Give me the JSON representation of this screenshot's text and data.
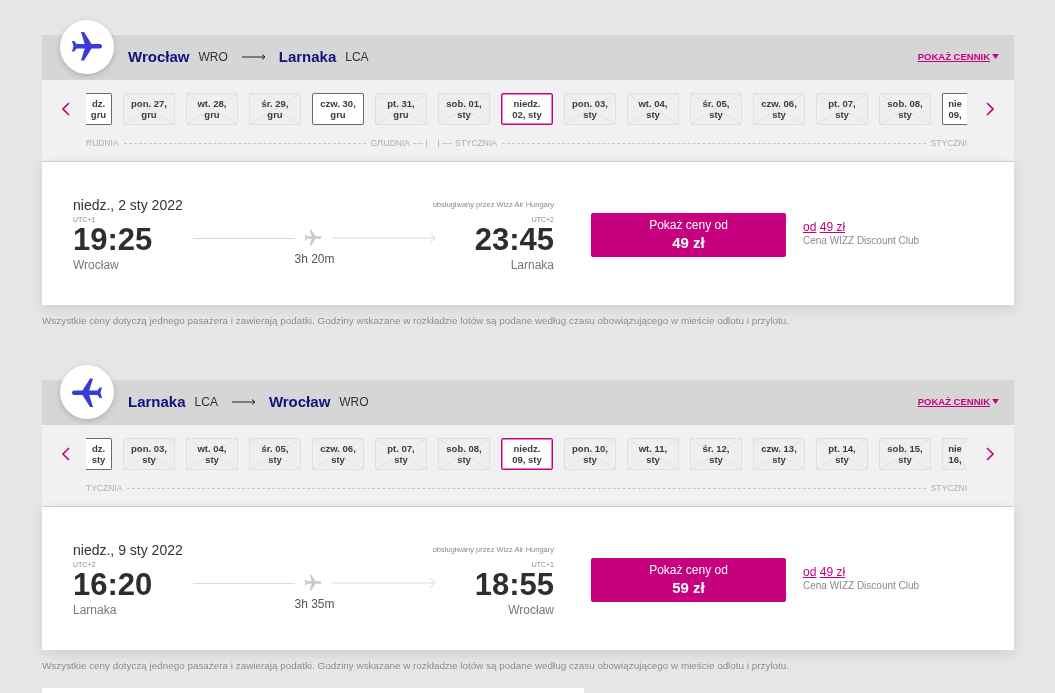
{
  "sections": [
    {
      "route": {
        "return_flight": false,
        "origin": {
          "city": "Wrocław",
          "code": "WRO"
        },
        "destination": {
          "city": "Larnaka",
          "code": "LCA"
        }
      },
      "price_list_link": "POKAŻ CENNIK",
      "date_strip": {
        "months": [
          {
            "start_label": "RUDNIA",
            "end_label": "GRUDNIA",
            "dates": [
              {
                "kind": "cutleft",
                "lines": [
                  "dz.",
                  "gru"
                ],
                "available": true,
                "selected": false
              },
              {
                "kind": "full",
                "lines": [
                  "pon. 27,",
                  "gru"
                ],
                "available": false,
                "selected": false
              },
              {
                "kind": "full",
                "lines": [
                  "wt. 28,",
                  "gru"
                ],
                "available": false,
                "selected": false
              },
              {
                "kind": "full",
                "lines": [
                  "śr. 29,",
                  "gru"
                ],
                "available": false,
                "selected": false
              },
              {
                "kind": "full",
                "lines": [
                  "czw. 30,",
                  "gru"
                ],
                "available": true,
                "selected": false
              },
              {
                "kind": "full",
                "lines": [
                  "pt. 31,",
                  "gru"
                ],
                "available": false,
                "selected": false
              }
            ]
          },
          {
            "start_label": "STYCZNIA",
            "end_label": "STYCZNI",
            "dates": [
              {
                "kind": "full",
                "lines": [
                  "sob. 01,",
                  "sty"
                ],
                "available": false,
                "selected": false
              },
              {
                "kind": "full",
                "lines": [
                  "niedz.",
                  "02, sty"
                ],
                "available": true,
                "selected": true
              },
              {
                "kind": "full",
                "lines": [
                  "pon. 03,",
                  "sty"
                ],
                "available": false,
                "selected": false
              },
              {
                "kind": "full",
                "lines": [
                  "wt. 04,",
                  "sty"
                ],
                "available": false,
                "selected": false
              },
              {
                "kind": "full",
                "lines": [
                  "śr. 05,",
                  "sty"
                ],
                "available": false,
                "selected": false
              },
              {
                "kind": "full",
                "lines": [
                  "czw. 06,",
                  "sty"
                ],
                "available": false,
                "selected": false
              },
              {
                "kind": "full",
                "lines": [
                  "pt. 07,",
                  "sty"
                ],
                "available": false,
                "selected": false
              },
              {
                "kind": "full",
                "lines": [
                  "sob. 08,",
                  "sty"
                ],
                "available": false,
                "selected": false
              },
              {
                "kind": "cutright",
                "lines": [
                  "nie",
                  "09,"
                ],
                "available": true,
                "selected": false
              }
            ]
          }
        ]
      },
      "flight": {
        "date": "niedz., 2 sty 2022",
        "operator": "obsługiwany przez Wizz Air Hungary",
        "departure": {
          "utc": "UTC+1",
          "time": "19:25",
          "city": "Wrocław"
        },
        "duration": "3h 20m",
        "arrival": {
          "utc": "UTC+2",
          "time": "23:45",
          "city": "Larnaka"
        },
        "price_button": {
          "label": "Pokaż ceny od",
          "price": "49 zł"
        },
        "club_price": {
          "prefix": "od",
          "price": "49 zł",
          "caption": "Cena WIZZ Discount Club"
        }
      },
      "disclaimer": "Wszystkie ceny dotyczą jednego pasażera i zawierają podatki. Godziny wskazane w rozkładzie lotów są podane według czasu obowiązującego w mieście odlotu i przylotu."
    },
    {
      "route": {
        "return_flight": true,
        "origin": {
          "city": "Larnaka",
          "code": "LCA"
        },
        "destination": {
          "city": "Wrocław",
          "code": "WRO"
        }
      },
      "price_list_link": "POKAŻ CENNIK",
      "date_strip": {
        "months": [
          {
            "start_label": "TYCZNIA",
            "end_label": "STYCZNI",
            "dates": [
              {
                "kind": "cutleft",
                "lines": [
                  "dz.",
                  "sty"
                ],
                "available": true,
                "selected": false
              },
              {
                "kind": "full",
                "lines": [
                  "pon. 03,",
                  "sty"
                ],
                "available": false,
                "selected": false
              },
              {
                "kind": "full",
                "lines": [
                  "wt. 04,",
                  "sty"
                ],
                "available": false,
                "selected": false
              },
              {
                "kind": "full",
                "lines": [
                  "śr. 05,",
                  "sty"
                ],
                "available": false,
                "selected": false
              },
              {
                "kind": "full",
                "lines": [
                  "czw. 06,",
                  "sty"
                ],
                "available": false,
                "selected": false
              },
              {
                "kind": "full",
                "lines": [
                  "pt. 07,",
                  "sty"
                ],
                "available": false,
                "selected": false
              },
              {
                "kind": "full",
                "lines": [
                  "sob. 08,",
                  "sty"
                ],
                "available": false,
                "selected": false
              },
              {
                "kind": "full",
                "lines": [
                  "niedz.",
                  "09, sty"
                ],
                "available": true,
                "selected": true
              },
              {
                "kind": "full",
                "lines": [
                  "pon. 10,",
                  "sty"
                ],
                "available": false,
                "selected": false
              },
              {
                "kind": "full",
                "lines": [
                  "wt. 11,",
                  "sty"
                ],
                "available": false,
                "selected": false
              },
              {
                "kind": "full",
                "lines": [
                  "śr. 12,",
                  "sty"
                ],
                "available": false,
                "selected": false
              },
              {
                "kind": "full",
                "lines": [
                  "czw. 13,",
                  "sty"
                ],
                "available": false,
                "selected": false
              },
              {
                "kind": "full",
                "lines": [
                  "pt. 14,",
                  "sty"
                ],
                "available": false,
                "selected": false
              },
              {
                "kind": "full",
                "lines": [
                  "sob. 15,",
                  "sty"
                ],
                "available": false,
                "selected": false
              },
              {
                "kind": "cutright",
                "lines": [
                  "nie",
                  "16,"
                ],
                "available": false,
                "selected": false
              }
            ]
          }
        ]
      },
      "flight": {
        "date": "niedz., 9 sty 2022",
        "operator": "obsługiwany przez Wizz Air Hungary",
        "departure": {
          "utc": "UTC+2",
          "time": "16:20",
          "city": "Larnaka"
        },
        "duration": "3h 35m",
        "arrival": {
          "utc": "UTC+1",
          "time": "18:55",
          "city": "Wrocław"
        },
        "price_button": {
          "label": "Pokaż ceny od",
          "price": "59 zł"
        },
        "club_price": {
          "prefix": "od",
          "price": "49 zł",
          "caption": "Cena WIZZ Discount Club"
        }
      },
      "disclaimer": "Wszystkie ceny dotyczą jednego pasażera i zawierają podatki. Godziny wskazane w rozkładzie lotów są podane według czasu obowiązującego w mieście odlotu i przylotu."
    }
  ]
}
